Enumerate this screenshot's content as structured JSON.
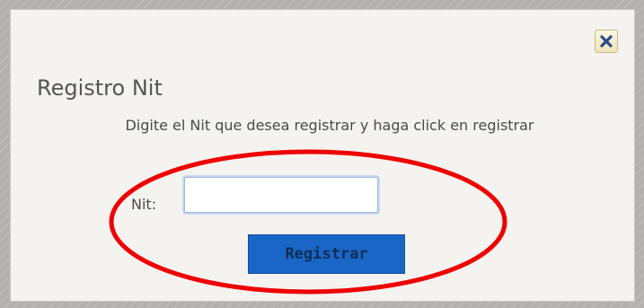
{
  "dialog": {
    "close_icon": "close-icon",
    "title": "Registro Nit",
    "instruction": "Digite el Nit que desea registrar y haga click en registrar",
    "form": {
      "nit_label": "Nit:",
      "nit_value": "",
      "nit_placeholder": "",
      "submit_label": "Registrar"
    }
  },
  "annotation": {
    "type": "red-ellipse",
    "color": "#ee0000"
  },
  "colors": {
    "button_bg": "#1a66c6",
    "button_text": "#0c2e55",
    "close_icon": "#2b4c8c",
    "dialog_bg": "#f4f3f0"
  }
}
